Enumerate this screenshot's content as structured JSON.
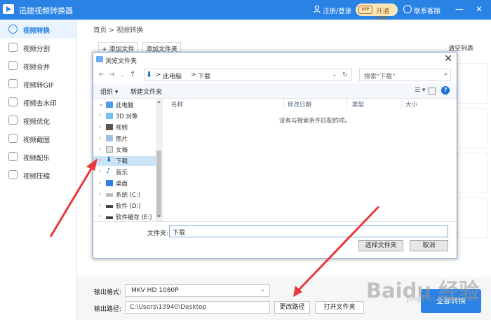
{
  "app": {
    "title": "迅捷视频转换器",
    "login": "注册/登录",
    "vip": "开通VIP",
    "vip_badge": "VIP",
    "service": "联系客服",
    "accent": "#2a82e4"
  },
  "window_controls": {
    "minimize": "—",
    "close": "✕"
  },
  "sidebar": {
    "items": [
      {
        "label": "视频转换",
        "icon": "convert-icon",
        "active": true
      },
      {
        "label": "视频分割",
        "icon": "split-icon"
      },
      {
        "label": "视频合并",
        "icon": "merge-icon"
      },
      {
        "label": "视频转GIF",
        "icon": "gif-icon"
      },
      {
        "label": "视频去水印",
        "icon": "watermark-icon"
      },
      {
        "label": "视频优化",
        "icon": "optimize-icon"
      },
      {
        "label": "视频截图",
        "icon": "screenshot-icon"
      },
      {
        "label": "视频配乐",
        "icon": "music-icon"
      },
      {
        "label": "视频压缩",
        "icon": "compress-icon"
      }
    ]
  },
  "main": {
    "breadcrumb": "首页 > 视频转换",
    "add_file": "+ 添加文件",
    "add_folder": "添加文件夹",
    "clear_list": "清空列表"
  },
  "dialog": {
    "title": "浏览文件夹",
    "close": "✕",
    "path_root": "此电脑",
    "path_sep": ">",
    "path_current": "下载",
    "search_placeholder": "搜索\"下载\"",
    "organize": "组织 ▾",
    "new_folder": "新建文件夹",
    "tree": [
      {
        "label": "此电脑",
        "icon": "computer-icon",
        "expanded": true
      },
      {
        "label": "3D 对象",
        "icon": "3d-objects-icon"
      },
      {
        "label": "视频",
        "icon": "video-folder-icon"
      },
      {
        "label": "图片",
        "icon": "pictures-icon"
      },
      {
        "label": "文档",
        "icon": "documents-icon"
      },
      {
        "label": "下载",
        "icon": "download-icon",
        "selected": true
      },
      {
        "label": "音乐",
        "icon": "music-note-icon"
      },
      {
        "label": "桌面",
        "icon": "desktop-icon"
      },
      {
        "label": "系统 (C:)",
        "icon": "drive-icon"
      },
      {
        "label": "软件 (D:)",
        "icon": "drive-icon"
      },
      {
        "label": "软件缓存 (E:)",
        "icon": "drive-icon"
      }
    ],
    "columns": [
      "名称",
      "修改日期",
      "类型",
      "大小"
    ],
    "empty_text": "没有与搜索条件匹配的项。",
    "filename_label": "文件夹:",
    "filename_value": "下载",
    "select_btn": "选择文件夹",
    "cancel_btn": "取消"
  },
  "bottom": {
    "format_label": "输出格式:",
    "format_value": "MKV  HD 1080P",
    "path_label": "输出路径:",
    "path_value": "C:\\Users\\13940\\Desktop",
    "change_path": "更改路径",
    "open_folder": "打开文件夹",
    "convert_all": "全部转换"
  },
  "watermark": {
    "text": "Baidu 经验",
    "sub": "jingyan.baidu.com"
  }
}
